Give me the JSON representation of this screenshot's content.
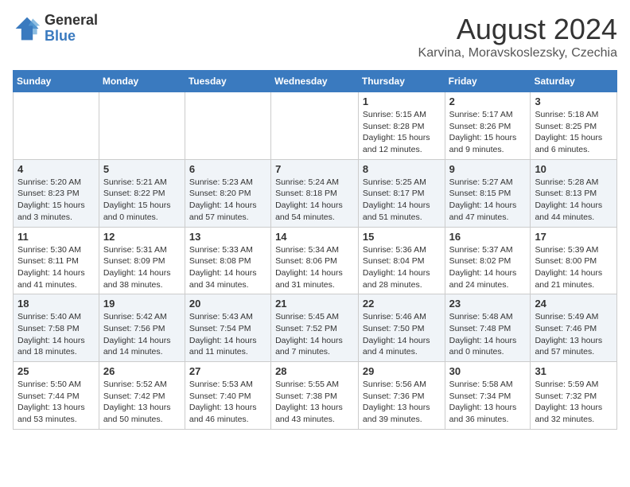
{
  "logo": {
    "general": "General",
    "blue": "Blue"
  },
  "title": "August 2024",
  "location": "Karvina, Moravskoslezsky, Czechia",
  "days_of_week": [
    "Sunday",
    "Monday",
    "Tuesday",
    "Wednesday",
    "Thursday",
    "Friday",
    "Saturday"
  ],
  "weeks": [
    [
      {
        "day": "",
        "info": ""
      },
      {
        "day": "",
        "info": ""
      },
      {
        "day": "",
        "info": ""
      },
      {
        "day": "",
        "info": ""
      },
      {
        "day": "1",
        "sunrise": "5:15 AM",
        "sunset": "8:28 PM",
        "daylight": "15 hours and 12 minutes."
      },
      {
        "day": "2",
        "sunrise": "5:17 AM",
        "sunset": "8:26 PM",
        "daylight": "15 hours and 9 minutes."
      },
      {
        "day": "3",
        "sunrise": "5:18 AM",
        "sunset": "8:25 PM",
        "daylight": "15 hours and 6 minutes."
      }
    ],
    [
      {
        "day": "4",
        "sunrise": "5:20 AM",
        "sunset": "8:23 PM",
        "daylight": "15 hours and 3 minutes."
      },
      {
        "day": "5",
        "sunrise": "5:21 AM",
        "sunset": "8:22 PM",
        "daylight": "15 hours and 0 minutes."
      },
      {
        "day": "6",
        "sunrise": "5:23 AM",
        "sunset": "8:20 PM",
        "daylight": "14 hours and 57 minutes."
      },
      {
        "day": "7",
        "sunrise": "5:24 AM",
        "sunset": "8:18 PM",
        "daylight": "14 hours and 54 minutes."
      },
      {
        "day": "8",
        "sunrise": "5:25 AM",
        "sunset": "8:17 PM",
        "daylight": "14 hours and 51 minutes."
      },
      {
        "day": "9",
        "sunrise": "5:27 AM",
        "sunset": "8:15 PM",
        "daylight": "14 hours and 47 minutes."
      },
      {
        "day": "10",
        "sunrise": "5:28 AM",
        "sunset": "8:13 PM",
        "daylight": "14 hours and 44 minutes."
      }
    ],
    [
      {
        "day": "11",
        "sunrise": "5:30 AM",
        "sunset": "8:11 PM",
        "daylight": "14 hours and 41 minutes."
      },
      {
        "day": "12",
        "sunrise": "5:31 AM",
        "sunset": "8:09 PM",
        "daylight": "14 hours and 38 minutes."
      },
      {
        "day": "13",
        "sunrise": "5:33 AM",
        "sunset": "8:08 PM",
        "daylight": "14 hours and 34 minutes."
      },
      {
        "day": "14",
        "sunrise": "5:34 AM",
        "sunset": "8:06 PM",
        "daylight": "14 hours and 31 minutes."
      },
      {
        "day": "15",
        "sunrise": "5:36 AM",
        "sunset": "8:04 PM",
        "daylight": "14 hours and 28 minutes."
      },
      {
        "day": "16",
        "sunrise": "5:37 AM",
        "sunset": "8:02 PM",
        "daylight": "14 hours and 24 minutes."
      },
      {
        "day": "17",
        "sunrise": "5:39 AM",
        "sunset": "8:00 PM",
        "daylight": "14 hours and 21 minutes."
      }
    ],
    [
      {
        "day": "18",
        "sunrise": "5:40 AM",
        "sunset": "7:58 PM",
        "daylight": "14 hours and 18 minutes."
      },
      {
        "day": "19",
        "sunrise": "5:42 AM",
        "sunset": "7:56 PM",
        "daylight": "14 hours and 14 minutes."
      },
      {
        "day": "20",
        "sunrise": "5:43 AM",
        "sunset": "7:54 PM",
        "daylight": "14 hours and 11 minutes."
      },
      {
        "day": "21",
        "sunrise": "5:45 AM",
        "sunset": "7:52 PM",
        "daylight": "14 hours and 7 minutes."
      },
      {
        "day": "22",
        "sunrise": "5:46 AM",
        "sunset": "7:50 PM",
        "daylight": "14 hours and 4 minutes."
      },
      {
        "day": "23",
        "sunrise": "5:48 AM",
        "sunset": "7:48 PM",
        "daylight": "14 hours and 0 minutes."
      },
      {
        "day": "24",
        "sunrise": "5:49 AM",
        "sunset": "7:46 PM",
        "daylight": "13 hours and 57 minutes."
      }
    ],
    [
      {
        "day": "25",
        "sunrise": "5:50 AM",
        "sunset": "7:44 PM",
        "daylight": "13 hours and 53 minutes."
      },
      {
        "day": "26",
        "sunrise": "5:52 AM",
        "sunset": "7:42 PM",
        "daylight": "13 hours and 50 minutes."
      },
      {
        "day": "27",
        "sunrise": "5:53 AM",
        "sunset": "7:40 PM",
        "daylight": "13 hours and 46 minutes."
      },
      {
        "day": "28",
        "sunrise": "5:55 AM",
        "sunset": "7:38 PM",
        "daylight": "13 hours and 43 minutes."
      },
      {
        "day": "29",
        "sunrise": "5:56 AM",
        "sunset": "7:36 PM",
        "daylight": "13 hours and 39 minutes."
      },
      {
        "day": "30",
        "sunrise": "5:58 AM",
        "sunset": "7:34 PM",
        "daylight": "13 hours and 36 minutes."
      },
      {
        "day": "31",
        "sunrise": "5:59 AM",
        "sunset": "7:32 PM",
        "daylight": "13 hours and 32 minutes."
      }
    ]
  ],
  "labels": {
    "sunrise": "Sunrise:",
    "sunset": "Sunset:",
    "daylight": "Daylight:"
  },
  "colors": {
    "header_bg": "#3a7abf",
    "header_text": "#ffffff",
    "row_odd": "#ffffff",
    "row_even": "#f0f4f8"
  }
}
